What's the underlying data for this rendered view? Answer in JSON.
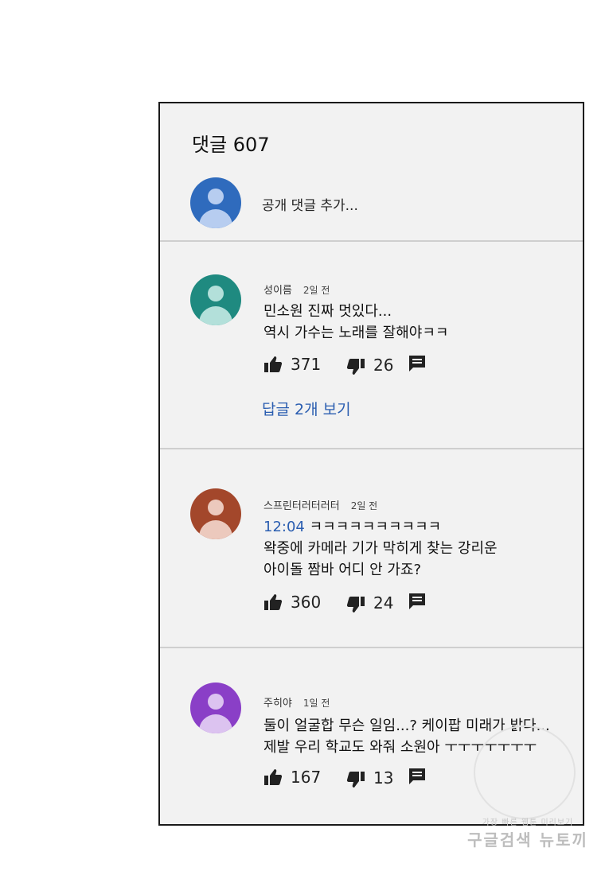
{
  "header": {
    "title": "댓글 607"
  },
  "compose": {
    "placeholder": "공개 댓글 추가..."
  },
  "colors": {
    "link": "#2a5db0",
    "avatar_me": "#2f6bbd",
    "avatar_1": "#1f8a80",
    "avatar_2": "#a3472b",
    "avatar_3": "#8a3fc7"
  },
  "comments": [
    {
      "author": "성이름",
      "time": "2일 전",
      "timestamp": "",
      "lines": [
        "민소원 진짜 멋있다...",
        "역시 가수는 노래를 잘해야ㅋㅋ"
      ],
      "likes": "371",
      "dislikes": "26",
      "replies": "답글 2개 보기",
      "icons": [
        "thumb-up-icon",
        "thumb-down-icon",
        "reply-icon"
      ]
    },
    {
      "author": "스프린터러터러터",
      "time": "2일 전",
      "timestamp": "12:04",
      "first_line_rest": " ㅋㅋㅋㅋㅋㅋㅋㅋㅋㅋ",
      "lines": [
        "왁중에 카메라 기가 막히게 찾는 강리운",
        "아이돌 짬바 어디 안 가죠?"
      ],
      "likes": "360",
      "dislikes": "24",
      "icons": [
        "thumb-up-icon",
        "thumb-down-icon",
        "reply-icon"
      ]
    },
    {
      "author": "주히야",
      "time": "1일 전",
      "timestamp": "",
      "lines": [
        "둘이 얼굴합 무슨 일임...? 케이팝 미래가 밝다...",
        "제발 우리 학교도 와줘 소원아 ㅜㅜㅜㅜㅜㅜㅜ"
      ],
      "likes": "167",
      "dislikes": "13",
      "icons": [
        "thumb-up-icon",
        "thumb-down-icon",
        "reply-icon"
      ]
    }
  ],
  "watermark": {
    "line1": "가장 빠른 웹툰 미리보기",
    "line2": "구글검색 뉴토끼"
  }
}
